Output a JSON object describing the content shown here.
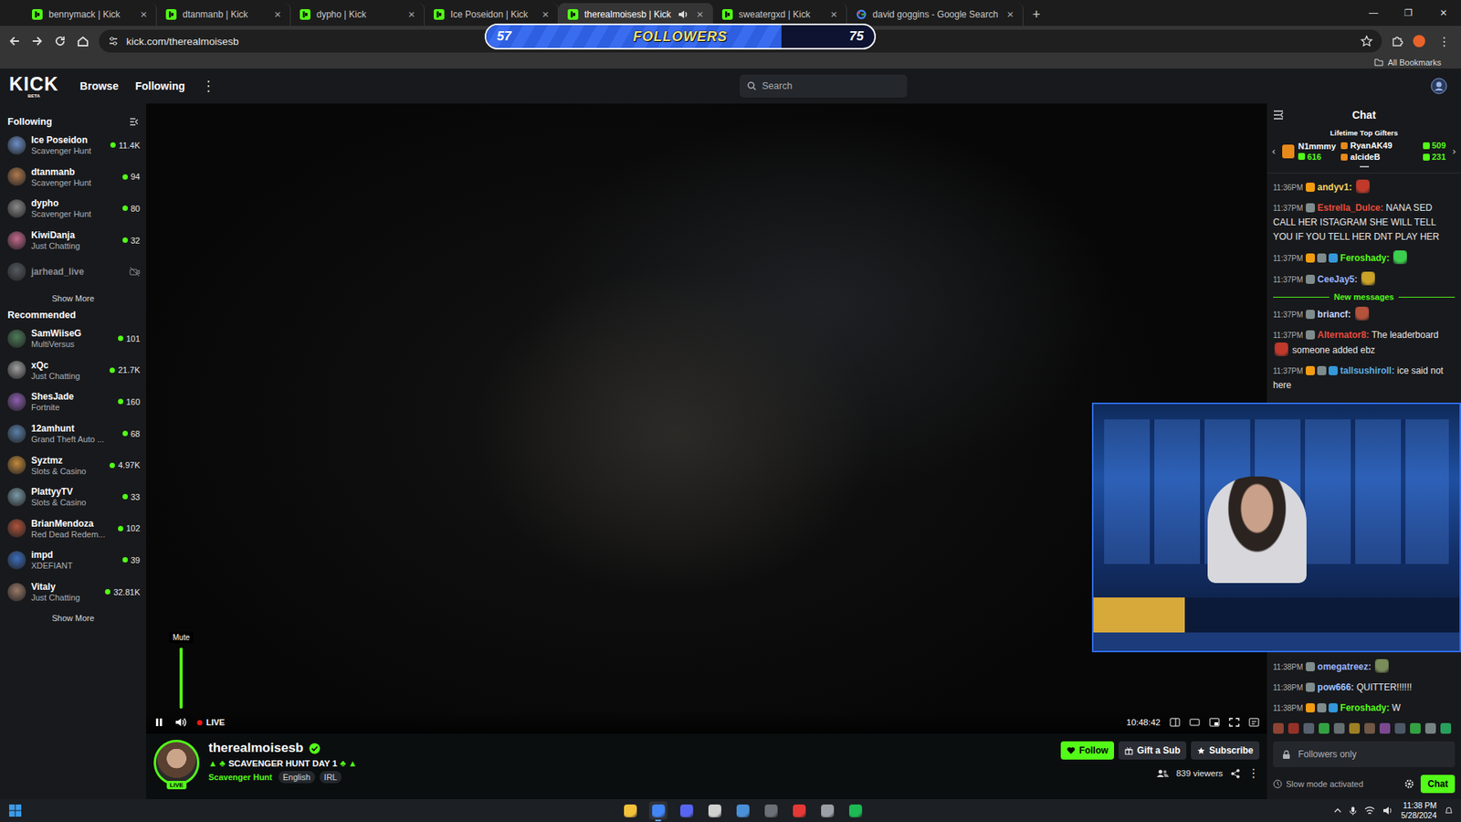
{
  "browser": {
    "tabs": [
      {
        "label": "bennymack | Kick",
        "selected": false,
        "kind": "kick",
        "audio": false
      },
      {
        "label": "dtanmanb | Kick",
        "selected": false,
        "kind": "kick",
        "audio": false
      },
      {
        "label": "dypho | Kick",
        "selected": false,
        "kind": "kick",
        "audio": false
      },
      {
        "label": "Ice Poseidon | Kick",
        "selected": false,
        "kind": "kick",
        "audio": false
      },
      {
        "label": "therealmoisesb | Kick",
        "selected": true,
        "kind": "kick",
        "audio": true
      },
      {
        "label": "sweatergxd | Kick",
        "selected": false,
        "kind": "kick",
        "audio": false
      },
      {
        "label": "david goggins - Google Search",
        "selected": false,
        "kind": "google",
        "audio": false
      }
    ],
    "tab_close": "×",
    "new_tab": "+",
    "window_controls": [
      "—",
      "❐",
      "✕"
    ],
    "address": "kick.com/therealmoisesb",
    "menu": "⋮",
    "bookmarks": "All Bookmarks"
  },
  "follower_goal": {
    "current": "57",
    "label": "FOLLOWERS",
    "goal": "75",
    "level": 0.76
  },
  "header": {
    "logo": "KICK",
    "badge": "BETA",
    "nav": [
      "Browse",
      "Following"
    ],
    "more": "⋮",
    "search": {
      "placeholder": "Search"
    }
  },
  "sidebar": {
    "following_title": "Following",
    "following": [
      {
        "name": "Ice Poseidon",
        "category": "Scavenger Hunt",
        "viewers": "11.4K",
        "live": true
      },
      {
        "name": "dtanmanb",
        "category": "Scavenger Hunt",
        "viewers": "94",
        "live": true
      },
      {
        "name": "dypho",
        "category": "Scavenger Hunt",
        "viewers": "80",
        "live": true
      },
      {
        "name": "KiwiDanja",
        "category": "Just Chatting",
        "viewers": "32",
        "live": true
      },
      {
        "name": "jarhead_live",
        "live": false
      }
    ],
    "show_more": "Show More",
    "recommended_title": "Recommended",
    "recommended": [
      {
        "name": "SamWiiseG",
        "category": "MultiVersus",
        "viewers": "101",
        "live": true
      },
      {
        "name": "xQc",
        "category": "Just Chatting",
        "viewers": "21.7K",
        "live": true
      },
      {
        "name": "ShesJade",
        "category": "Fortnite",
        "viewers": "160",
        "live": true
      },
      {
        "name": "12amhunt",
        "category": "Grand Theft Auto ...",
        "viewers": "68",
        "live": true
      },
      {
        "name": "Syztmz",
        "category": "Slots & Casino",
        "viewers": "4.97K",
        "live": true
      },
      {
        "name": "PlattyyTV",
        "category": "Slots & Casino",
        "viewers": "33",
        "live": true
      },
      {
        "name": "BrianMendoza",
        "category": "Red Dead Redem...",
        "viewers": "102",
        "live": true
      },
      {
        "name": "impd",
        "category": "XDEFIANT",
        "viewers": "39",
        "live": true
      },
      {
        "name": "Vitaly",
        "category": "Just Chatting",
        "viewers": "32.81K",
        "live": true
      }
    ],
    "show_more_2": "Show More"
  },
  "player": {
    "playing": true,
    "muted": false,
    "volume": 1,
    "tooltip": "Mute",
    "live": "LIVE",
    "time": "10:48:42"
  },
  "channel": {
    "name": "therealmoisesb",
    "verified": true,
    "live_badge": "LIVE",
    "title_prefix": "▲ ♣",
    "title": "SCAVENGER HUNT DAY 1",
    "title_suffix": "♣ ▲",
    "category": "Scavenger Hunt",
    "tags": [
      "English",
      "IRL"
    ],
    "follow": "Follow",
    "gift": "Gift a Sub",
    "subscribe": "Subscribe",
    "viewers": "839 viewers",
    "more": "⋮"
  },
  "chat": {
    "title": "Chat",
    "gifters_title": "Lifetime Top Gifters",
    "prev": "‹",
    "next": "›",
    "gifters": [
      {
        "name": "N1mmmy",
        "amount": "616"
      },
      {
        "name": "RyanAK49",
        "amount": "509"
      },
      {
        "name": "alcideB",
        "amount": "231"
      }
    ],
    "separator": ":",
    "messages": [
      {
        "kind": "message",
        "time": "11:36PM",
        "user": "andyv1",
        "color": "#f4d35e",
        "badges": [
          "#f39c12"
        ],
        "parts": [
          {
            "kind": "emote",
            "color": "#c0392b"
          }
        ]
      },
      {
        "kind": "message",
        "time": "11:37PM",
        "user": "Estrella_Dulce",
        "color": "#e74c3c",
        "badges": [
          "#7f8c8d"
        ],
        "parts": [
          {
            "kind": "text",
            "text": "NANA SED CALL HER ISTAGRAM SHE WILL TELL YOU IF YOU TELL HER DNT PLAY HER"
          }
        ]
      },
      {
        "kind": "message",
        "time": "11:37PM",
        "user": "Feroshady",
        "color": "#53fc18",
        "badges": [
          "#f39c12",
          "#7f8c8d",
          "#3498db"
        ],
        "parts": [
          {
            "kind": "emote",
            "color": "#3ccf4e"
          }
        ]
      },
      {
        "kind": "message",
        "time": "11:37PM",
        "user": "CeeJay5",
        "color": "#9ab4ff",
        "badges": [
          "#7f8c8d"
        ],
        "parts": [
          {
            "kind": "emote",
            "color": "#c9a227"
          }
        ]
      },
      {
        "kind": "divider",
        "text": "New messages"
      },
      {
        "kind": "message",
        "time": "11:37PM",
        "user": "briancf",
        "color": "#c8d4ff",
        "badges": [
          "#7f8c8d"
        ],
        "parts": [
          {
            "kind": "emote",
            "color": "#b5523b"
          }
        ]
      },
      {
        "kind": "message",
        "time": "11:37PM",
        "user": "Alternator8",
        "color": "#e74c3c",
        "badges": [
          "#7f8c8d"
        ],
        "parts": [
          {
            "kind": "text",
            "text": "The leaderboard"
          },
          {
            "kind": "emote",
            "color": "#c0392b"
          },
          {
            "kind": "text",
            "text": "someone added ebz"
          }
        ]
      },
      {
        "kind": "message",
        "time": "11:37PM",
        "user": "tallsushiroll",
        "color": "#5dade2",
        "badges": [
          "#f39c12",
          "#7f8c8d",
          "#3498db"
        ],
        "parts": [
          {
            "kind": "text",
            "text": "ice said not here"
          }
        ]
      }
    ],
    "recent": [
      {
        "kind": "message",
        "time": "11:38PM",
        "user": "omegatreez",
        "color": "#9ab4ff",
        "badges": [
          "#7f8c8d"
        ],
        "parts": [
          {
            "kind": "emote",
            "color": "#7a8c5a"
          }
        ]
      },
      {
        "kind": "message",
        "time": "11:38PM",
        "user": "pow666",
        "color": "#a0c4ff",
        "badges": [
          "#7f8c8d"
        ],
        "parts": [
          {
            "kind": "text",
            "text": "QUITTER!!!!!!"
          }
        ]
      },
      {
        "kind": "message",
        "time": "11:38PM",
        "user": "Feroshady",
        "color": "#53fc18",
        "badges": [
          "#f39c12",
          "#7f8c8d",
          "#3498db"
        ],
        "parts": [
          {
            "kind": "text",
            "text": "W"
          }
        ]
      }
    ],
    "emote_bar": [
      "#b5523b",
      "#c0392b",
      "#6c7a89",
      "#3ccf4e",
      "#7f8c8d",
      "#c9a227",
      "#8e6e53",
      "#9b59b6",
      "#5d6d7e",
      "#3ccf4e",
      "#95a5a6",
      "#2ecc71"
    ],
    "input_placeholder": "Followers only",
    "slow_mode": "Slow mode activated",
    "send": "Chat"
  },
  "pip": {
    "open": true
  },
  "taskbar": {
    "apps": [
      {
        "color": "#f3c13a",
        "selected": false
      },
      {
        "color": "#4285f4",
        "selected": true
      },
      {
        "color": "#5865f2",
        "selected": false
      },
      {
        "color": "#d0d0d0",
        "selected": false
      },
      {
        "color": "#4a90d9",
        "selected": false
      },
      {
        "color": "#6b6f76",
        "selected": false
      },
      {
        "color": "#e53935",
        "selected": false
      },
      {
        "color": "#9aa0a6",
        "selected": false
      },
      {
        "color": "#1db954",
        "selected": false
      }
    ],
    "time": "11:38 PM",
    "date": "5/28/2024"
  }
}
